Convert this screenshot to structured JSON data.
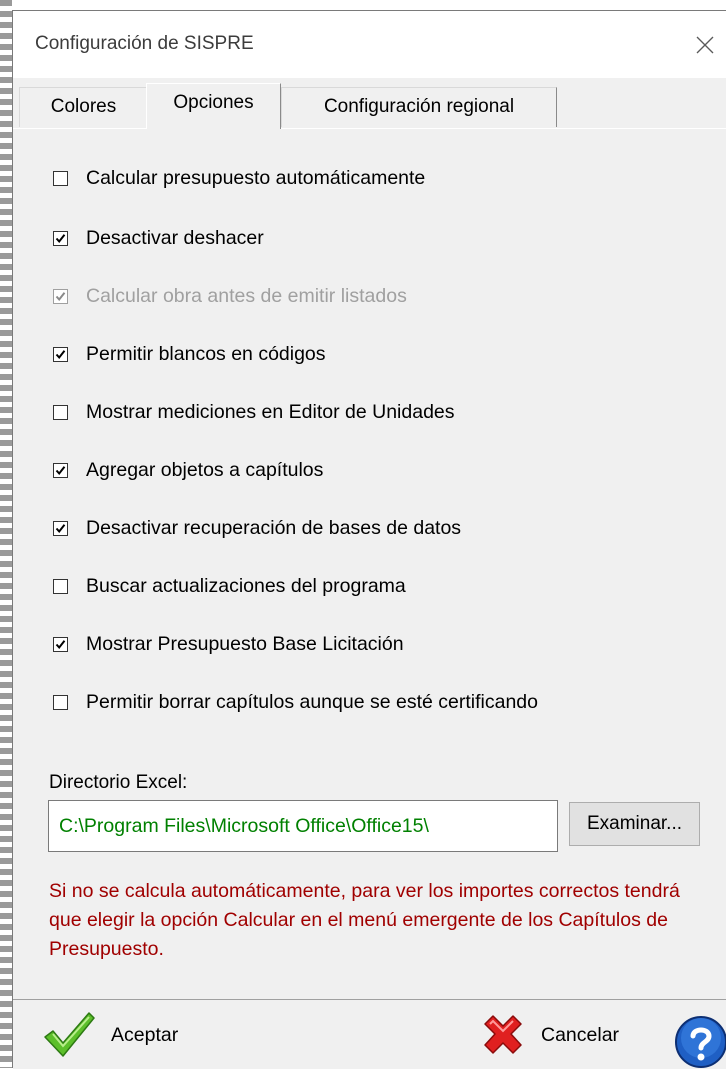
{
  "window": {
    "title": "Configuración de SISPRE"
  },
  "tabs": [
    {
      "label": "Colores",
      "active": false
    },
    {
      "label": "Opciones",
      "active": true
    },
    {
      "label": "Configuración regional",
      "active": false
    }
  ],
  "options": [
    {
      "label": "Calcular presupuesto automáticamente",
      "checked": false,
      "enabled": true
    },
    {
      "label": "Desactivar deshacer",
      "checked": true,
      "enabled": true
    },
    {
      "label": "Calcular obra antes de emitir listados",
      "checked": true,
      "enabled": false
    },
    {
      "label": "Permitir blancos en códigos",
      "checked": true,
      "enabled": true
    },
    {
      "label": "Mostrar mediciones en Editor de Unidades",
      "checked": false,
      "enabled": true
    },
    {
      "label": "Agregar objetos a capítulos",
      "checked": true,
      "enabled": true
    },
    {
      "label": "Desactivar recuperación de bases de datos",
      "checked": true,
      "enabled": true
    },
    {
      "label": "Buscar actualizaciones del programa",
      "checked": false,
      "enabled": true
    },
    {
      "label": "Mostrar Presupuesto Base Licitación",
      "checked": true,
      "enabled": true
    },
    {
      "label": "Permitir borrar capítulos aunque se esté certificando",
      "checked": false,
      "enabled": true
    }
  ],
  "excel": {
    "label": "Directorio Excel:",
    "value": "C:\\Program Files\\Microsoft Office\\Office15\\",
    "browse_label": "Examinar..."
  },
  "note": "Si no se calcula automáticamente, para ver los importes correctos tendrá que elegir la opción Calcular en el menú emergente de los Capítulos de Presupuesto.",
  "footer": {
    "ok_label": "Aceptar",
    "cancel_label": "Cancelar"
  },
  "colors": {
    "note_text": "#a00000",
    "path_text": "#008000",
    "disabled_text": "#a0a0a0"
  }
}
